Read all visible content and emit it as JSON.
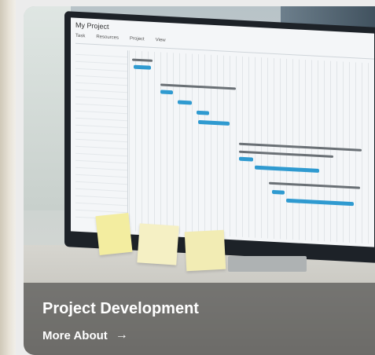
{
  "card": {
    "title": "Project Development",
    "link_label": "More About",
    "link_icon": "→"
  },
  "screen": {
    "window_title": "My Project",
    "menu": [
      "Task",
      "Resources",
      "Project",
      "View"
    ]
  },
  "colors": {
    "overlay": "#2d2d2d",
    "gantt_bar": "#2f9ad0",
    "text": "#ffffff"
  }
}
